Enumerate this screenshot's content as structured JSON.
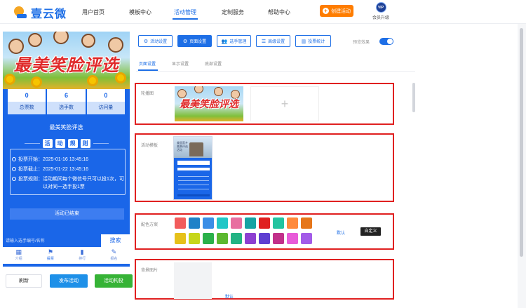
{
  "brand": {
    "name": "壹云微"
  },
  "nav": {
    "items": [
      "用户首页",
      "模板中心",
      "活动管理",
      "定制服务",
      "帮助中心"
    ],
    "active": "活动管理",
    "create_label": "创建活动",
    "vip_badge": "VIP",
    "vip_label": "会员升级"
  },
  "preview": {
    "banner_title": "最美笑脸评选",
    "stats": [
      {
        "value": "0",
        "label": "总票数"
      },
      {
        "value": "6",
        "label": "选手数"
      },
      {
        "value": "0",
        "label": "访问量"
      }
    ],
    "title": "最美笑脸评选",
    "rules_heading": [
      "活",
      "动",
      "规",
      "则"
    ],
    "rules": [
      "投票开始：2025-01-16 13:45:16",
      "投票截止：2025-01-22 13:45:16",
      "投票规则：活动期间每个微信号只可以投1次，可",
      "以对同一选手投1票"
    ],
    "effect_label": "活动已结束",
    "search_placeholder": "请输入选手编号/名称",
    "search_button": "搜索",
    "tabs": [
      {
        "label": "介绍",
        "icon": "grid-icon"
      },
      {
        "label": "投票",
        "icon": "flag-icon"
      },
      {
        "label": "排行",
        "icon": "bar-chart-icon"
      },
      {
        "label": "报名",
        "icon": "signup-icon"
      }
    ],
    "active_tab": "投票"
  },
  "actions": {
    "reset": "刷新",
    "publish": "发布活动",
    "preview": "活动构投"
  },
  "toolbar": {
    "buttons": [
      {
        "label": "活动设置",
        "icon": "gear-icon"
      },
      {
        "label": "页面设置",
        "icon": "gear-icon"
      },
      {
        "label": "选手管理",
        "icon": "users-icon"
      },
      {
        "label": "高级设置",
        "icon": "advanced-icon"
      },
      {
        "label": "投票统计",
        "icon": "stats-icon"
      }
    ],
    "active": "页面设置",
    "preview_toggle_label": "预览效果",
    "preview_toggle_on": true
  },
  "subtabs": {
    "items": [
      "页面设置",
      "显示设置",
      "底部设置"
    ],
    "active": "页面设置"
  },
  "sections": {
    "carousel": {
      "label": "轮播图",
      "image_title": "最美笑脸评选",
      "add_icon": "+"
    },
    "template": {
      "label": "活动模板",
      "thumb_title": "美丽家乡美景评选活动"
    },
    "colors": {
      "label": "配色方案",
      "swatches": [
        "#f25c5c",
        "#1f82c8",
        "#3a8ee6",
        "#21c7c7",
        "#e86fa0",
        "#16a3a3",
        "#e02020",
        "#23c4a0",
        "#ff8a3d",
        "#e6761a",
        "#e6c11a",
        "#c6d61a",
        "#2bb14a",
        "#5cb830",
        "#23b384",
        "#8d3fd1",
        "#5f3fd1",
        "#c2308a",
        "#e85bd8",
        "#a35be8"
      ],
      "default_label": "默认",
      "custom_label": "自定义"
    },
    "background": {
      "label": "背景图片",
      "default_label": "默认"
    }
  }
}
